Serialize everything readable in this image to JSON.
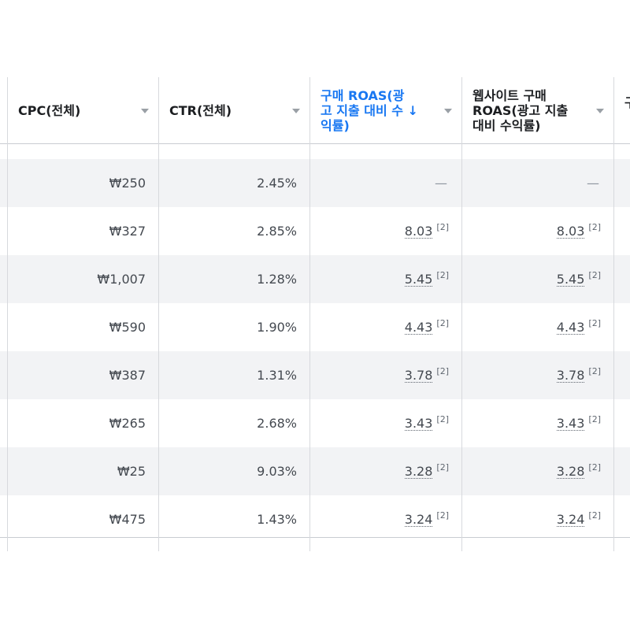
{
  "columns": {
    "cpc": "CPC(전체)",
    "ctr": "CTR(전체)",
    "purchase_roas": "구매 ROAS(광\n고 지출 대비 수 ↓\n익률)",
    "website_roas": "웹사이트 구매\nROAS(광고 지출\n대비 수익률)",
    "next_partial": "구"
  },
  "rows": [
    {
      "cpc": "₩250",
      "ctr": "2.45%",
      "roas": "—",
      "roas_note": "",
      "web_roas": "—",
      "web_note": ""
    },
    {
      "cpc": "₩327",
      "ctr": "2.85%",
      "roas": "8.03",
      "roas_note": "[2]",
      "web_roas": "8.03",
      "web_note": "[2]"
    },
    {
      "cpc": "₩1,007",
      "ctr": "1.28%",
      "roas": "5.45",
      "roas_note": "[2]",
      "web_roas": "5.45",
      "web_note": "[2]"
    },
    {
      "cpc": "₩590",
      "ctr": "1.90%",
      "roas": "4.43",
      "roas_note": "[2]",
      "web_roas": "4.43",
      "web_note": "[2]"
    },
    {
      "cpc": "₩387",
      "ctr": "1.31%",
      "roas": "3.78",
      "roas_note": "[2]",
      "web_roas": "3.78",
      "web_note": "[2]"
    },
    {
      "cpc": "₩265",
      "ctr": "2.68%",
      "roas": "3.43",
      "roas_note": "[2]",
      "web_roas": "3.43",
      "web_note": "[2]"
    },
    {
      "cpc": "₩25",
      "ctr": "9.03%",
      "roas": "3.28",
      "roas_note": "[2]",
      "web_roas": "3.28",
      "web_note": "[2]"
    },
    {
      "cpc": "₩475",
      "ctr": "1.43%",
      "roas": "3.24",
      "roas_note": "[2]",
      "web_roas": "3.24",
      "web_note": "[2]"
    }
  ],
  "colors": {
    "active_header": "#1877f2",
    "row_shade": "#f2f3f5",
    "grid_line": "#d7d9dd"
  },
  "icons": {
    "sort_caret": "chevron-down-icon",
    "sort_direction": "arrow-down-icon"
  }
}
